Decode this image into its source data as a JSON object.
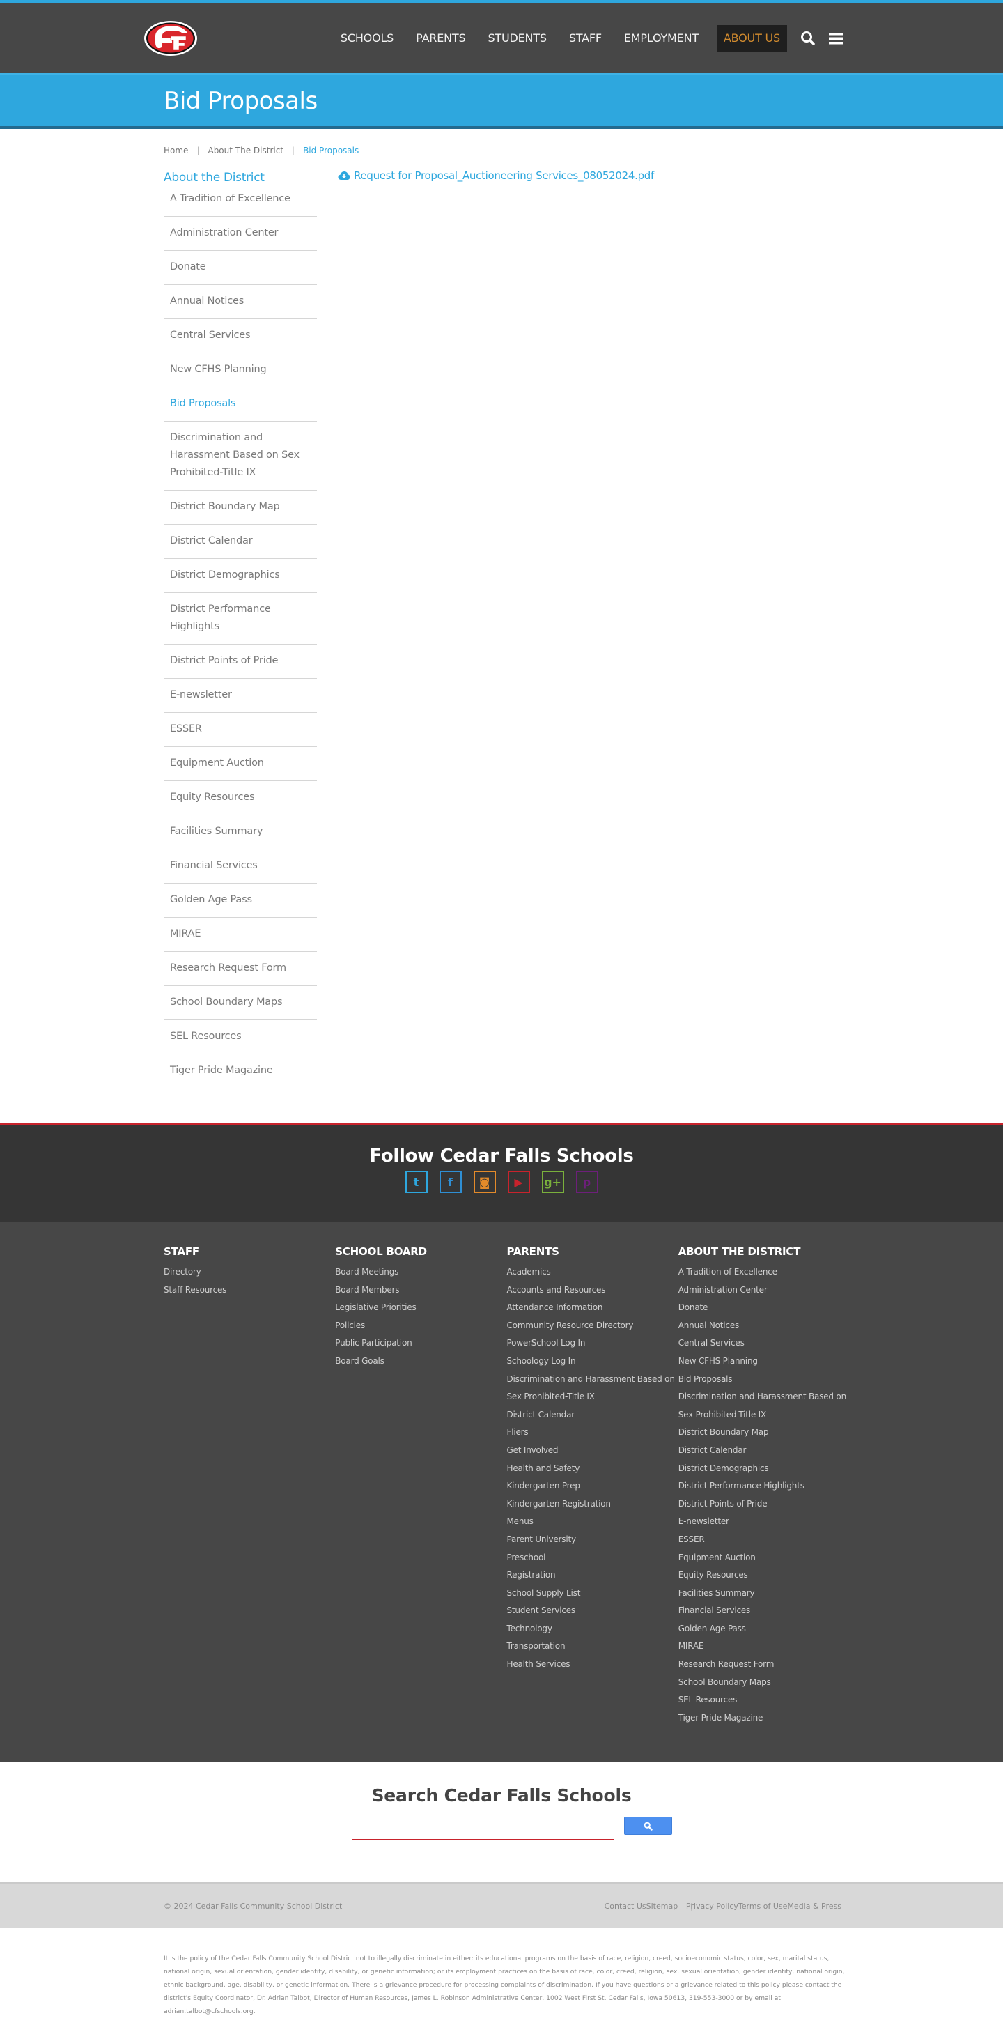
{
  "header": {
    "logo_alt": "Cedar Falls Schools logo",
    "nav": [
      {
        "label": "SCHOOLS"
      },
      {
        "label": "PARENTS"
      },
      {
        "label": "STUDENTS"
      },
      {
        "label": "STAFF"
      },
      {
        "label": "EMPLOYMENT"
      },
      {
        "label": "ABOUT US",
        "active": true
      }
    ],
    "icons": [
      "search-icon",
      "menu-icon"
    ]
  },
  "banner": {
    "title": "Bid Proposals"
  },
  "breadcrumb": [
    "Home",
    "About The District",
    "Bid Proposals"
  ],
  "sidebar": {
    "title": "About the District",
    "items": [
      "A Tradition of Excellence",
      "Administration Center",
      "Donate",
      "Annual Notices",
      "Central Services",
      "New CFHS Planning",
      "Bid Proposals",
      "Discrimination and Harassment Based on Sex Prohibited-Title IX",
      "District Boundary Map",
      "District Calendar",
      "District Demographics",
      "District Performance Highlights",
      "District Points of Pride",
      "E-newsletter",
      "ESSER",
      "Equipment Auction",
      "Equity Resources",
      "Facilities Summary",
      "Financial Services",
      "Golden Age Pass",
      "MIRAE",
      "Research Request Form",
      "School Boundary Maps",
      "SEL Resources",
      "Tiger Pride Magazine"
    ],
    "active_index": 6
  },
  "content": {
    "document_link": "Request for Proposal_Auctioneering Services_08052024.pdf",
    "document_icon": "cloud-download-icon"
  },
  "social": {
    "title": "Follow Cedar Falls Schools",
    "icons": [
      {
        "name": "twitter-icon",
        "glyph": "t",
        "color": "#2ea7de"
      },
      {
        "name": "facebook-icon",
        "glyph": "f",
        "color": "#2f8fd4"
      },
      {
        "name": "instagram-icon",
        "glyph": "◙",
        "color": "#e38a2a"
      },
      {
        "name": "youtube-icon",
        "glyph": "▶",
        "color": "#c8232c"
      },
      {
        "name": "google-plus-icon",
        "glyph": "g+",
        "color": "#7ab03c"
      },
      {
        "name": "pinterest-icon",
        "glyph": "p",
        "color": "#6d1f7a"
      }
    ]
  },
  "footer": {
    "columns": [
      {
        "heading": "STAFF",
        "links": [
          "Directory",
          "Staff Resources"
        ]
      },
      {
        "heading": "SCHOOL BOARD",
        "links": [
          "Board Meetings",
          "Board Members",
          "Legislative Priorities",
          "Policies",
          "Public Participation",
          "Board Goals"
        ]
      },
      {
        "heading": "PARENTS",
        "links": [
          "Academics",
          "Accounts and Resources",
          "Attendance Information",
          "Community Resource Directory",
          "PowerSchool Log In",
          "Schoology Log In",
          "Discrimination and Harassment Based on",
          "Sex Prohibited-Title IX",
          "District Calendar",
          "Fliers",
          "Get Involved",
          "Health and Safety",
          "Kindergarten Prep",
          "Kindergarten Registration",
          "Menus",
          "Parent University",
          "Preschool",
          "Registration",
          "School Supply List",
          "Student Services",
          "Technology",
          "Transportation",
          "Health Services"
        ]
      },
      {
        "heading": "ABOUT THE DISTRICT",
        "links": [
          "A Tradition of Excellence",
          "Administration Center",
          "Donate",
          "Annual Notices",
          "Central Services",
          "New CFHS Planning",
          "Bid Proposals",
          "Discrimination and Harassment Based on",
          "Sex Prohibited-Title IX",
          "District Boundary Map",
          "District Calendar",
          "District Demographics",
          "District Performance Highlights",
          "District Points of Pride",
          "E-newsletter",
          "ESSER",
          "Equipment Auction",
          "Equity Resources",
          "Facilities Summary",
          "Financial Services",
          "Golden Age Pass",
          "MIRAE",
          "Research Request Form",
          "School Boundary Maps",
          "SEL Resources",
          "Tiger Pride Magazine"
        ]
      }
    ]
  },
  "search": {
    "title": "Search Cedar Falls Schools",
    "value": "",
    "placeholder": ""
  },
  "bottombar": {
    "copyright": "© 2024 Cedar Falls Community School District",
    "links": [
      "Contact Us",
      "Sitemap",
      "Privacy Policy",
      "Terms of Use",
      "Media & Press"
    ]
  },
  "policy": {
    "text": "It is the policy of the Cedar Falls Community School District not to illegally discriminate in either: its educational programs on the basis of race, religion, creed, socioeconomic status, color, sex, marital status, national origin, sexual orientation, gender identity, disability, or genetic information; or its employment practices on the basis of race, color, creed, religion, sex, sexual orientation, gender identity, national origin, ethnic background, age, disability, or genetic information. There is a grievance procedure for processing complaints of discrimination. If you have questions or a grievance related to this policy please contact the district's Equity Coordinator, Dr. Adrian Talbot, Director of Human Resources, James L. Robinson Administrative Center, 1002 West First St. Cedar Falls, Iowa 50613, 319-553-3000 or by email at adrian.talbot@cfschools.org."
  },
  "colors": {
    "accent_blue": "#2ea7de",
    "header_gray": "#474747",
    "active_nav": "#d08a2e",
    "brand_red": "#c8232c",
    "search_button": "#4d90f0"
  }
}
